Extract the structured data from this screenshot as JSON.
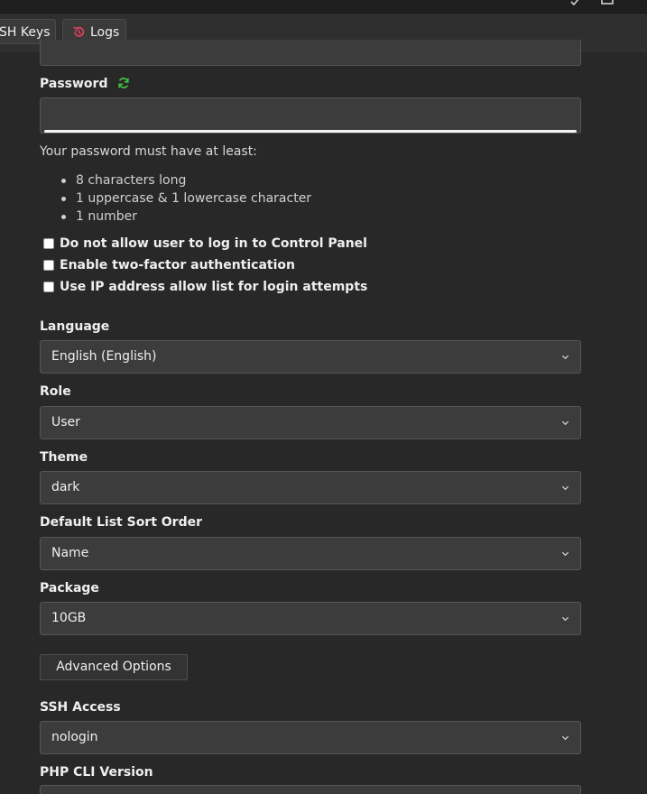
{
  "tabs": {
    "ssh_keys": "SH Keys",
    "logs": "Logs"
  },
  "password": {
    "label": "Password",
    "hint": "Your password must have at least:",
    "requirements": [
      "8 characters long",
      "1 uppercase & 1 lowercase character",
      "1 number"
    ]
  },
  "checkboxes": [
    "Do not allow user to log in to Control Panel",
    "Enable two-factor authentication",
    "Use IP address allow list for login attempts"
  ],
  "fields": {
    "language": {
      "label": "Language",
      "value": "English (English)"
    },
    "role": {
      "label": "Role",
      "value": "User"
    },
    "theme": {
      "label": "Theme",
      "value": "dark"
    },
    "sort_order": {
      "label": "Default List Sort Order",
      "value": "Name"
    },
    "package": {
      "label": "Package",
      "value": "10GB"
    },
    "ssh_access": {
      "label": "SSH Access",
      "value": "nologin"
    },
    "php_cli": {
      "label": "PHP CLI Version"
    }
  },
  "advanced_button": "Advanced Options",
  "colors": {
    "background": "#282828",
    "input": "#3c3c3c",
    "refresh_icon": "#3fbf3f",
    "logs_icon": "#e0405a"
  }
}
